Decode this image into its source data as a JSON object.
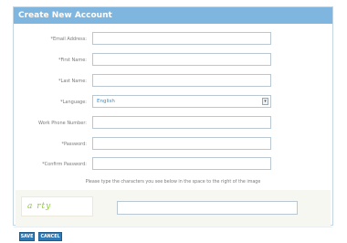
{
  "form": {
    "title": "Create New Account",
    "fields": [
      {
        "label": "*Email Address:",
        "value": ""
      },
      {
        "label": "*First Name:",
        "value": ""
      },
      {
        "label": "*Last Name:",
        "value": ""
      },
      {
        "label": "*Language:",
        "value": "English"
      },
      {
        "label": "Work Phone Number:",
        "value": ""
      },
      {
        "label": "*Password:",
        "value": ""
      },
      {
        "label": "*Confirm Password:",
        "value": ""
      }
    ],
    "captcha_instructions": "Please type the characters you see below in the space to the right of the image",
    "captcha_text": "a rty",
    "captcha_value": "",
    "save_label": "SAVE",
    "cancel_label": "CANCEL"
  }
}
